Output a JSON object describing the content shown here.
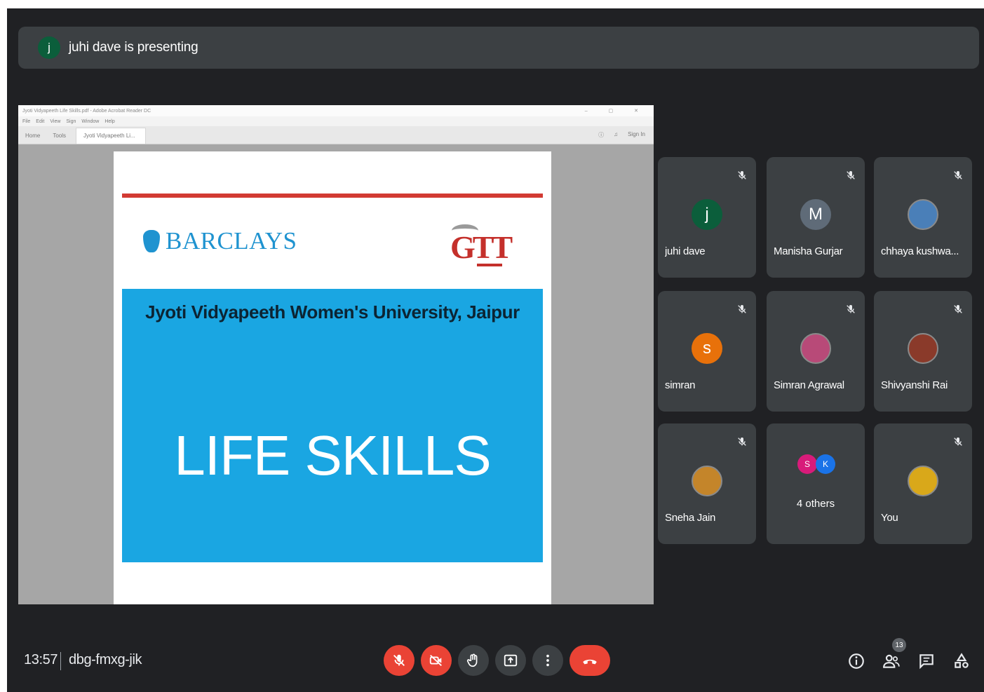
{
  "banner": {
    "avatar_initial": "j",
    "text": "juhi dave is presenting"
  },
  "shared_screen": {
    "window_title": "Jyoti Vidyapeeth Life Skills.pdf - Adobe Acrobat Reader DC",
    "menu": [
      "File",
      "Edit",
      "View",
      "Sign",
      "Window",
      "Help"
    ],
    "tabs": [
      "Home",
      "Tools",
      "Jyoti Vidyapeeth Li..."
    ],
    "sign_in": "Sign In",
    "slide": {
      "logo_left": "BARCLAYS",
      "logo_right": "GTT",
      "university": "Jyoti Vidyapeeth Women's University, Jaipur",
      "title": "LIFE SKILLS"
    }
  },
  "participants": [
    {
      "name": "juhi dave",
      "initial": "j",
      "avatar_color": "#0b5e3b",
      "muted": true
    },
    {
      "name": "Manisha Gurjar",
      "initial": "M",
      "avatar_color": "#5f6b78",
      "muted": true
    },
    {
      "name": "chhaya kushwa...",
      "initial": "",
      "avatar_color": "#4a7fb8",
      "muted": true
    },
    {
      "name": "simran",
      "initial": "s",
      "avatar_color": "#e8710a",
      "muted": true
    },
    {
      "name": "Simran Agrawal",
      "initial": "",
      "avatar_color": "#b84a78",
      "muted": true
    },
    {
      "name": "Shivyanshi Rai",
      "initial": "",
      "avatar_color": "#8a3a2a",
      "muted": true
    },
    {
      "name": "Sneha Jain",
      "initial": "",
      "avatar_color": "#c4852a",
      "muted": true
    },
    {
      "name": "4 others",
      "initial": "",
      "avatar_color": "",
      "muted": false
    },
    {
      "name": "You",
      "initial": "",
      "avatar_color": "#d9a81a",
      "muted": true
    }
  ],
  "others_avatars": [
    {
      "initial": "S",
      "color": "#d81b7a"
    },
    {
      "initial": "K",
      "color": "#1a73e8"
    }
  ],
  "bottom_bar": {
    "time": "13:57",
    "meeting_code": "dbg-fmxg-jik",
    "people_count": "13",
    "colors": {
      "danger": "#ea4335",
      "control": "#3c4043",
      "background": "#202124"
    }
  }
}
